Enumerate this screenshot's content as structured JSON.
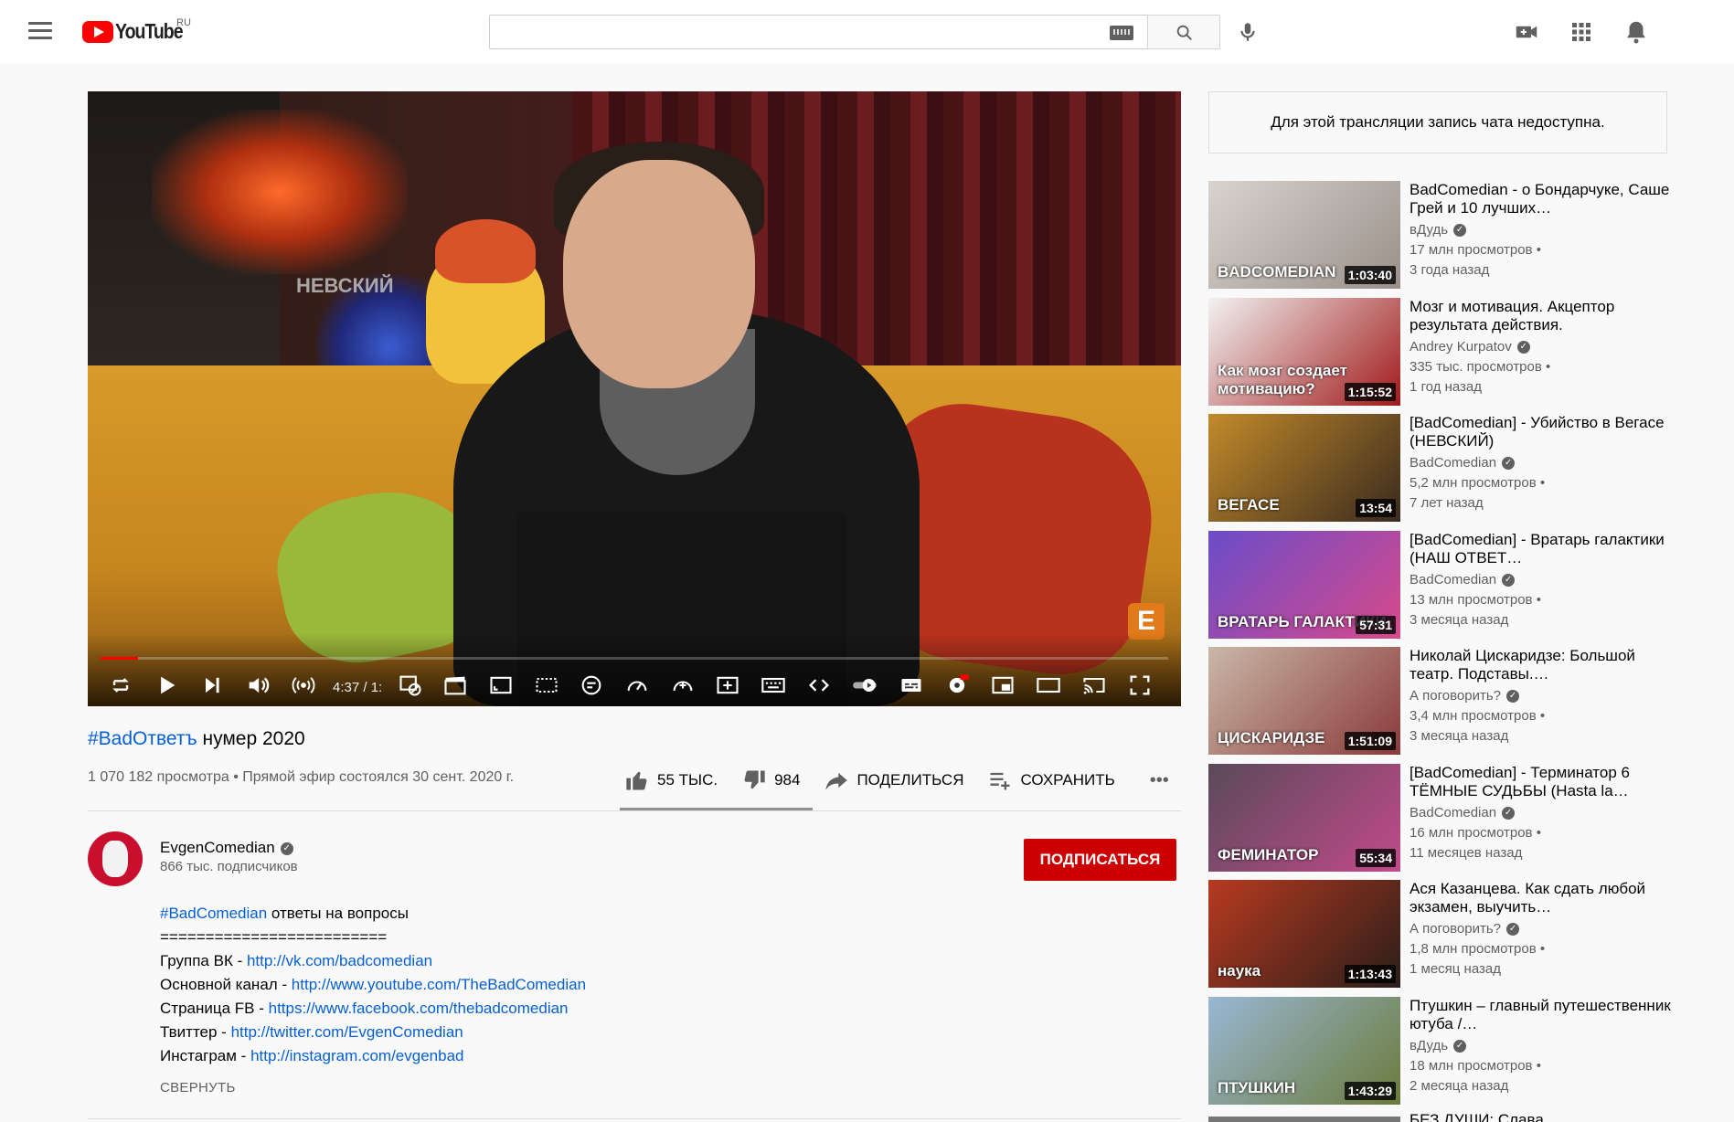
{
  "header": {
    "logo_text": "YouTube",
    "country": "RU",
    "search_value": ""
  },
  "player": {
    "time": "4:37 / 1:",
    "progress": 0.035,
    "brand_badge": "E",
    "book_text": "НЕВСКИЙ"
  },
  "video": {
    "hashtag": "#BadОтветъ",
    "title_rest": " нумер 2020",
    "meta": "1 070 182 просмотра • Прямой эфир состоялся 30 сент. 2020 г.",
    "likes": "55 ТЫС.",
    "dislikes": "984",
    "share": "ПОДЕЛИТЬСЯ",
    "save": "СОХРАНИТЬ",
    "more": "•••"
  },
  "channel": {
    "name": "EvgenComedian",
    "subs": "866 тыс. подписчиков",
    "subscribe": "ПОДПИСАТЬСЯ"
  },
  "description": {
    "line1_tag": "#BadComedian",
    "line1_rest": " ответы на вопросы",
    "line2": "=========================",
    "links": [
      {
        "label": "Группа ВК - ",
        "url": "http://vk.com/badcomedian"
      },
      {
        "label": "Основной канал - ",
        "url": "http://www.youtube.com/TheBadComedian"
      },
      {
        "label": "Страница FB - ",
        "url": "https://www.facebook.com/thebadcomedian"
      },
      {
        "label": "Твиттер - ",
        "url": "http://twitter.com/EvgenComedian"
      },
      {
        "label": "Инстаграм - ",
        "url": "http://instagram.com/evgenbad"
      }
    ],
    "collapse": "СВЕРНУТЬ"
  },
  "chat_notice": "Для этой трансляции запись чата недоступна.",
  "recommendations": [
    {
      "title": "BadComedian - о Бондарчуке, Саше Грей и 10 лучших…",
      "channel": "вДудь",
      "views": "17 млн просмотров •",
      "age": "3 года назад",
      "duration": "1:03:40",
      "overlay": "BADCOMEDIAN",
      "colors": [
        "#d8d3cf",
        "#9a9089"
      ]
    },
    {
      "title": "Мозг и мотивация. Акцептор результата действия.",
      "channel": "Andrey Kurpatov",
      "views": "335 тыс. просмотров •",
      "age": "1 год назад",
      "duration": "1:15:52",
      "overlay": "Как мозг создает мотивацию?",
      "colors": [
        "#f2f2f2",
        "#a11a1a"
      ]
    },
    {
      "title": "[BadComedian] - Убийство в Вегасе (НЕВСКИЙ)",
      "channel": "BadComedian",
      "views": "5,2 млн просмотров •",
      "age": "7 лет назад",
      "duration": "13:54",
      "overlay": "ВЕГАСЕ",
      "colors": [
        "#c28a2a",
        "#3a2a1e"
      ]
    },
    {
      "title": "[BadComedian] - Вратарь галактики (НАШ ОТВЕТ…",
      "channel": "BadComedian",
      "views": "13 млн просмотров •",
      "age": "3 месяца назад",
      "duration": "57:31",
      "overlay": "ВРАТАРЬ ГАЛАКТИКИ",
      "colors": [
        "#6a4cc9",
        "#d84a8a"
      ]
    },
    {
      "title": "Николай Цискаридзе: Большой театр. Подставы.…",
      "channel": "А поговорить?",
      "views": "3,4 млн просмотров •",
      "age": "3 месяца назад",
      "duration": "1:51:09",
      "overlay": "ЦИСКАРИДЗЕ",
      "colors": [
        "#c9b7a7",
        "#8a3a3a"
      ]
    },
    {
      "title": "[BadComedian] - Терминатор 6 ТЁМНЫЕ СУДЬБЫ (Hasta la…",
      "channel": "BadComedian",
      "views": "16 млн просмотров •",
      "age": "11 месяцев назад",
      "duration": "55:34",
      "overlay": "ФЕМИНАТОР",
      "colors": [
        "#5a4a5a",
        "#c24a8a"
      ]
    },
    {
      "title": "Ася Казанцева. Как сдать любой экзамен, выучить…",
      "channel": "А поговорить?",
      "views": "1,8 млн просмотров •",
      "age": "1 месяц назад",
      "duration": "1:13:43",
      "overlay": "наука",
      "colors": [
        "#b83a20",
        "#2a1e1a"
      ]
    },
    {
      "title": "Птушкин – главный путешественник ютуба /…",
      "channel": "вДудь",
      "views": "18 млн просмотров •",
      "age": "2 месяца назад",
      "duration": "1:43:29",
      "overlay": "ПТУШКИН",
      "colors": [
        "#9ab7d4",
        "#6a7a3a"
      ]
    }
  ],
  "next_peek_title": "БЕЗ ДУШИ: Слава",
  "colors": {
    "accent": "#cc0000",
    "link": "#065fd4",
    "progress": "#ff0000"
  }
}
